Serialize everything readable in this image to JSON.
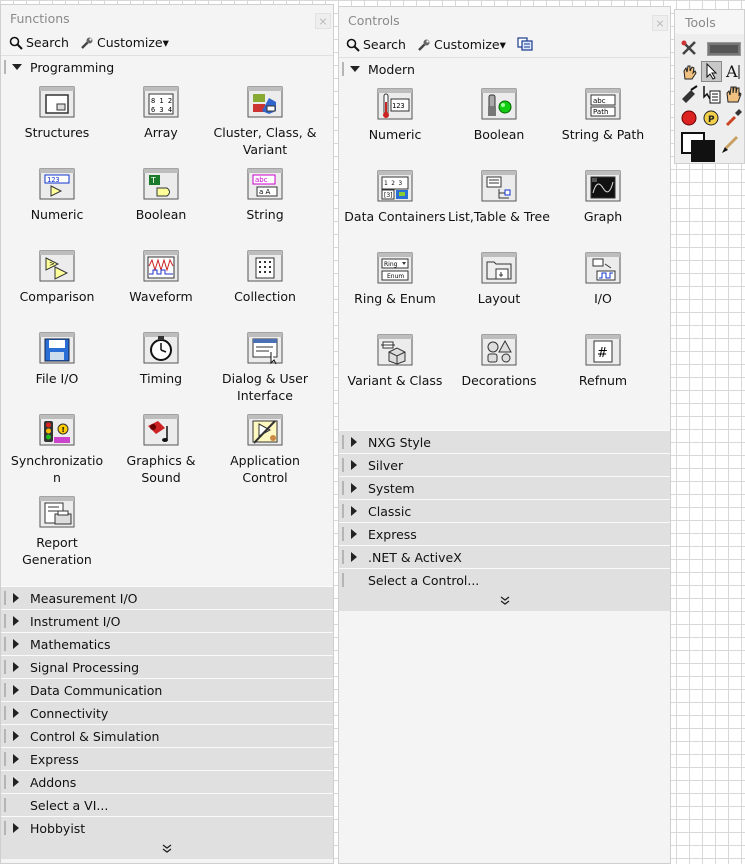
{
  "functions": {
    "title": "Functions",
    "search_label": "Search",
    "customize_label": "Customize▾",
    "section_title": "Programming",
    "items": [
      {
        "label": "Structures",
        "icon": "structures-icon"
      },
      {
        "label": "Array",
        "icon": "array-icon"
      },
      {
        "label": "Cluster, Class, & Variant",
        "icon": "cluster-class-variant-icon"
      },
      {
        "label": "Numeric",
        "icon": "numeric-function-icon"
      },
      {
        "label": "Boolean",
        "icon": "boolean-function-icon"
      },
      {
        "label": "String",
        "icon": "string-function-icon"
      },
      {
        "label": "Comparison",
        "icon": "comparison-icon"
      },
      {
        "label": "Waveform",
        "icon": "waveform-icon"
      },
      {
        "label": "Collection",
        "icon": "collection-icon"
      },
      {
        "label": "File I/O",
        "icon": "file-io-icon"
      },
      {
        "label": "Timing",
        "icon": "timing-icon"
      },
      {
        "label": "Dialog & User Interface",
        "icon": "dialog-ui-icon"
      },
      {
        "label": "Synchronizatio n",
        "icon": "synchronization-icon"
      },
      {
        "label": "Graphics & Sound",
        "icon": "graphics-sound-icon"
      },
      {
        "label": "Application Control",
        "icon": "application-control-icon"
      },
      {
        "label": "Report Generation",
        "icon": "report-generation-icon"
      }
    ],
    "categories": [
      {
        "label": "Measurement I/O",
        "expandable": true
      },
      {
        "label": "Instrument I/O",
        "expandable": true
      },
      {
        "label": "Mathematics",
        "expandable": true
      },
      {
        "label": "Signal Processing",
        "expandable": true
      },
      {
        "label": "Data Communication",
        "expandable": true
      },
      {
        "label": "Connectivity",
        "expandable": true
      },
      {
        "label": "Control & Simulation",
        "expandable": true
      },
      {
        "label": "Express",
        "expandable": true
      },
      {
        "label": "Addons",
        "expandable": true
      },
      {
        "label": "Select a VI...",
        "expandable": false
      },
      {
        "label": "Hobbyist",
        "expandable": true
      }
    ],
    "more_glyph": "»"
  },
  "controls": {
    "title": "Controls",
    "search_label": "Search",
    "customize_label": "Customize▾",
    "section_title": "Modern",
    "items": [
      {
        "label": "Numeric",
        "icon": "numeric-control-icon"
      },
      {
        "label": "Boolean",
        "icon": "boolean-control-icon"
      },
      {
        "label": "String & Path",
        "icon": "string-path-icon"
      },
      {
        "label": "Data Containers",
        "icon": "data-containers-icon"
      },
      {
        "label": "List,Table & Tree",
        "icon": "list-table-tree-icon"
      },
      {
        "label": "Graph",
        "icon": "graph-icon"
      },
      {
        "label": "Ring & Enum",
        "icon": "ring-enum-icon"
      },
      {
        "label": "Layout",
        "icon": "layout-icon"
      },
      {
        "label": "I/O",
        "icon": "io-icon"
      },
      {
        "label": "Variant & Class",
        "icon": "variant-class-icon"
      },
      {
        "label": "Decorations",
        "icon": "decorations-icon"
      },
      {
        "label": "Refnum",
        "icon": "refnum-icon"
      }
    ],
    "categories": [
      {
        "label": "NXG Style",
        "expandable": true
      },
      {
        "label": "Silver",
        "expandable": true
      },
      {
        "label": "System",
        "expandable": true
      },
      {
        "label": "Classic",
        "expandable": true
      },
      {
        "label": "Express",
        "expandable": true
      },
      {
        "label": ".NET & ActiveX",
        "expandable": true
      },
      {
        "label": "Select a Control...",
        "expandable": false
      }
    ],
    "more_glyph": "»",
    "icons": {
      "search": "search-icon",
      "customize": "wrench-icon",
      "view": "view-options-icon"
    }
  },
  "tools": {
    "title": "Tools",
    "items": [
      "automatic-tool-selection-icon",
      "automatic-tool-led-icon",
      "operate-value-icon",
      "position-select-icon",
      "edit-text-icon",
      "connect-wire-icon",
      "object-shortcut-menu-icon",
      "scroll-window-icon",
      "set-clear-breakpoint-icon",
      "probe-data-icon",
      "get-color-icon",
      "set-color-icon",
      "paintbrush-icon"
    ]
  }
}
